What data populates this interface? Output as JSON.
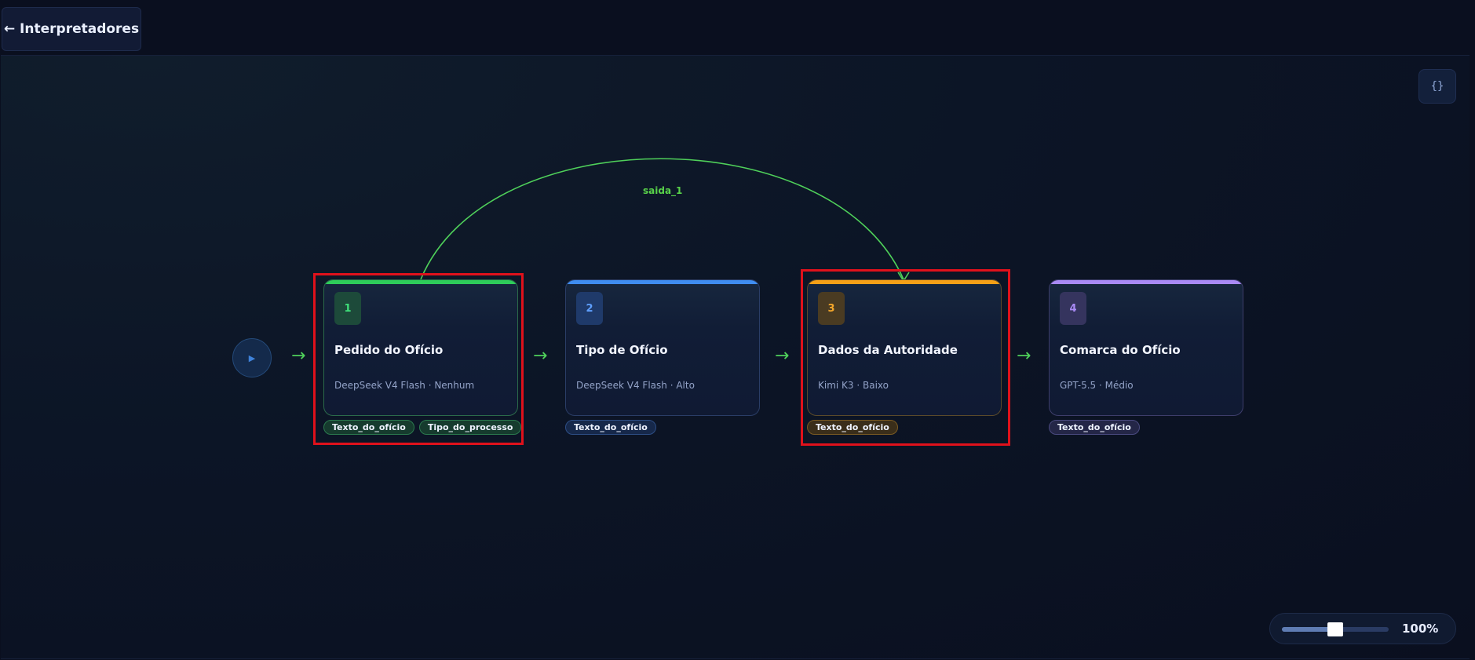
{
  "header": {
    "back_label": "← Interpretadores"
  },
  "toolbar": {
    "json_label": "{}"
  },
  "start": {
    "icon": "▶"
  },
  "edge": {
    "label": "saida_1",
    "color": "#4fd05a"
  },
  "nodes": [
    {
      "number": "1",
      "title": "Pedido do Ofício",
      "subtitle": "DeepSeek V4 Flash · Nenhum",
      "accent": "#2ecc5a",
      "tags": [
        "Texto_do_ofício",
        "Tipo_do_processo"
      ]
    },
    {
      "number": "2",
      "title": "Tipo de Ofício",
      "subtitle": "DeepSeek V4 Flash · Alto",
      "accent": "#3f8df0",
      "tags": [
        "Texto_do_ofício"
      ]
    },
    {
      "number": "3",
      "title": "Dados da Autoridade",
      "subtitle": "Kimi K3 · Baixo",
      "accent": "#f5a017",
      "tags": [
        "Texto_do_ofício"
      ]
    },
    {
      "number": "4",
      "title": "Comarca do Ofício",
      "subtitle": "GPT-5.5 · Médio",
      "accent": "#a98af5",
      "tags": [
        "Texto_do_ofício"
      ]
    }
  ],
  "arrow_glyph": "→",
  "zoom": {
    "value_label": "100%",
    "level": 0.5
  }
}
